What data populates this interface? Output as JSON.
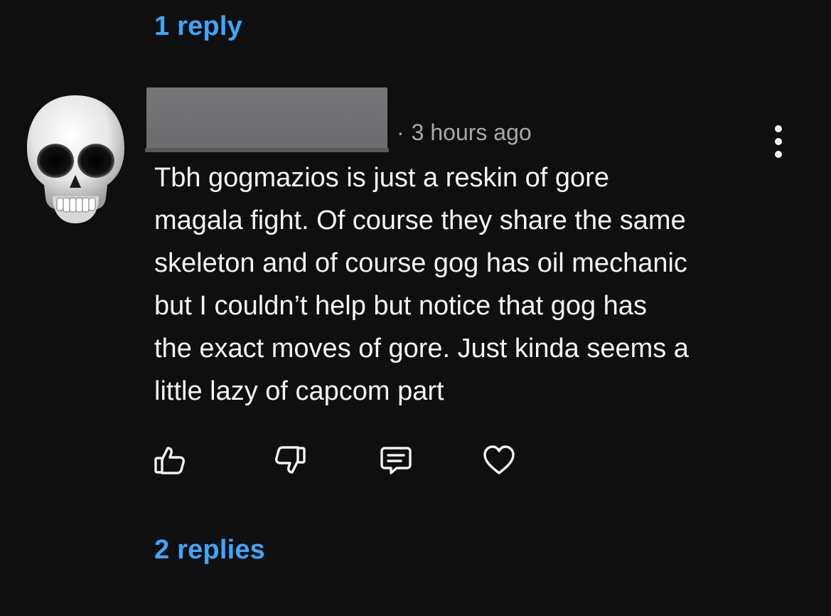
{
  "top_replies_label": "1 reply",
  "comment": {
    "author_redacted": true,
    "separator": "·",
    "timestamp": "3 hours ago",
    "text_lines": [
      "Tbh gogmazios is just a reskin of gore",
      "magala fight. Of course they share the same",
      "skeleton and of course gog has oil mechanic",
      "but I couldn’t help but notice that gog has",
      "the exact moves of gore. Just kinda seems a",
      "little lazy of capcom part"
    ],
    "actions": {
      "like_icon": "thumbs-up-icon",
      "dislike_icon": "thumbs-down-icon",
      "reply_icon": "comment-icon",
      "heart_icon": "heart-icon"
    },
    "avatar_icon": "skull-icon"
  },
  "bottom_replies_label": "2 replies",
  "colors": {
    "background": "#0f0f10",
    "link": "#3ea6ff",
    "text": "#f4f4f4",
    "meta": "#a9a9a9"
  }
}
